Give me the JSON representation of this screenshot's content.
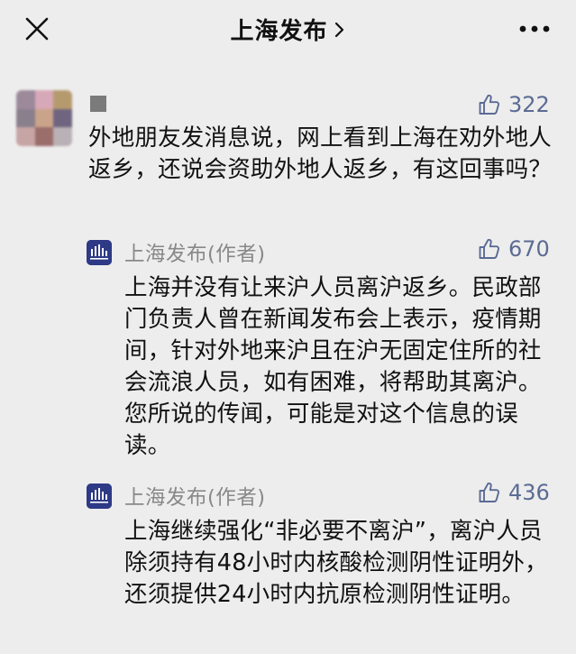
{
  "nav": {
    "title": "上海发布",
    "close_icon": "close-icon",
    "chevron_icon": "chevron-right-icon",
    "more_icon": "more-icon"
  },
  "comment": {
    "likes": "322",
    "text": "外地朋友发消息说，网上看到上海在劝外地人返乡，还说会资助外地人返乡，有这回事吗？"
  },
  "replies": [
    {
      "author": "上海发布(作者)",
      "likes": "670",
      "text": "上海并没有让来沪人员离沪返乡。民政部门负责人曾在新闻发布会上表示，疫情期间，针对外地来沪且在沪无固定住所的社会流浪人员，如有困难，将帮助其离沪。您所说的传闻，可能是对这个信息的误读。"
    },
    {
      "author": "上海发布(作者)",
      "likes": "436",
      "text": "上海继续强化“非必要不离沪”，离沪人员除须持有48小时内核酸检测阴性证明外，还须提供24小时内抗原检测阴性证明。"
    }
  ],
  "colors": {
    "background": "#ededed",
    "like_blue": "#5b6b94",
    "author_gray": "#888888",
    "logo_navy": "#2e3a86"
  }
}
